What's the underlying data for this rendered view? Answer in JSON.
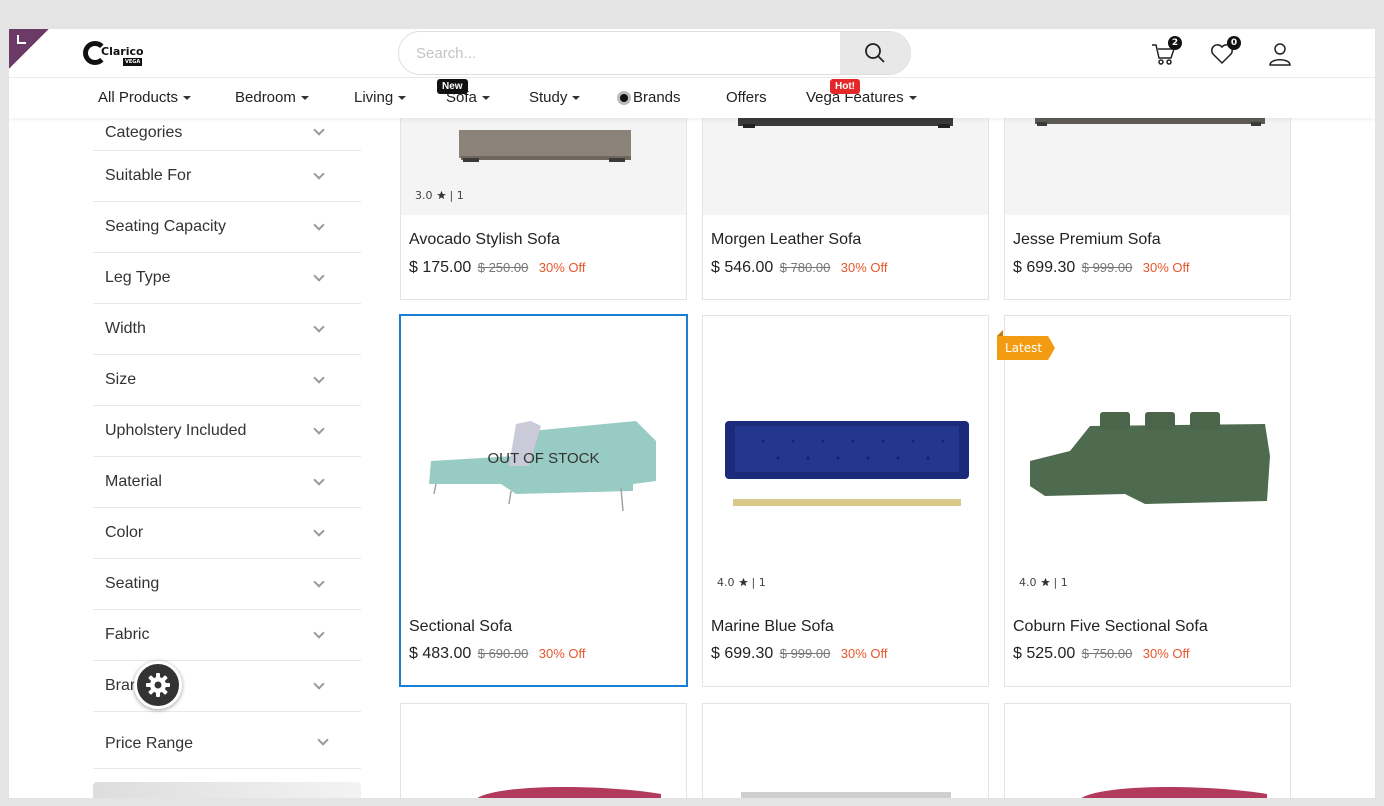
{
  "header": {
    "logo_text": "Clarico",
    "logo_sub": "VEGA",
    "search_placeholder": "Search...",
    "cart_count": "2",
    "wishlist_count": "0"
  },
  "nav": {
    "items": [
      {
        "label": "All Products",
        "dropdown": true
      },
      {
        "label": "Bedroom",
        "dropdown": true
      },
      {
        "label": "Living",
        "dropdown": true
      },
      {
        "label": "Sofa",
        "dropdown": true,
        "tag": "New"
      },
      {
        "label": "Study",
        "dropdown": true
      },
      {
        "label": "Brands",
        "dropdown": false
      },
      {
        "label": "Offers",
        "dropdown": false
      },
      {
        "label": "Vega Features",
        "dropdown": true,
        "tag": "Hot!"
      }
    ]
  },
  "sidebar": {
    "filters": [
      "Categories",
      "Suitable For",
      "Seating Capacity",
      "Leg Type",
      "Width",
      "Size",
      "Upholstery Included",
      "Material",
      "Color",
      "Seating",
      "Fabric",
      "Brand",
      "Price Range"
    ]
  },
  "products": [
    {
      "name": "Avocado Stylish Sofa",
      "price": "$ 175.00",
      "old_price": "$ 250.00",
      "discount": "30% Off",
      "rating": "3.0",
      "reviews": "| 1"
    },
    {
      "name": "Morgen Leather Sofa",
      "price": "$ 546.00",
      "old_price": "$ 780.00",
      "discount": "30% Off"
    },
    {
      "name": "Jesse Premium Sofa",
      "price": "$ 699.30",
      "old_price": "$ 999.00",
      "discount": "30% Off"
    },
    {
      "name": "Sectional Sofa",
      "price": "$ 483.00",
      "old_price": "$ 690.00",
      "discount": "30% Off",
      "stock": "OUT OF STOCK"
    },
    {
      "name": "Marine Blue Sofa",
      "price": "$ 699.30",
      "old_price": "$ 999.00",
      "discount": "30% Off",
      "rating": "4.0",
      "reviews": "| 1"
    },
    {
      "name": "Coburn Five Sectional Sofa",
      "price": "$ 525.00",
      "old_price": "$ 750.00",
      "discount": "30% Off",
      "rating": "4.0",
      "reviews": "| 1",
      "ribbon": "Latest"
    }
  ],
  "colors": {
    "accent_blue": "#1a7fd4",
    "discount": "#e8572b",
    "hot_tag": "#e62727",
    "latest_ribbon": "#f39c12"
  }
}
